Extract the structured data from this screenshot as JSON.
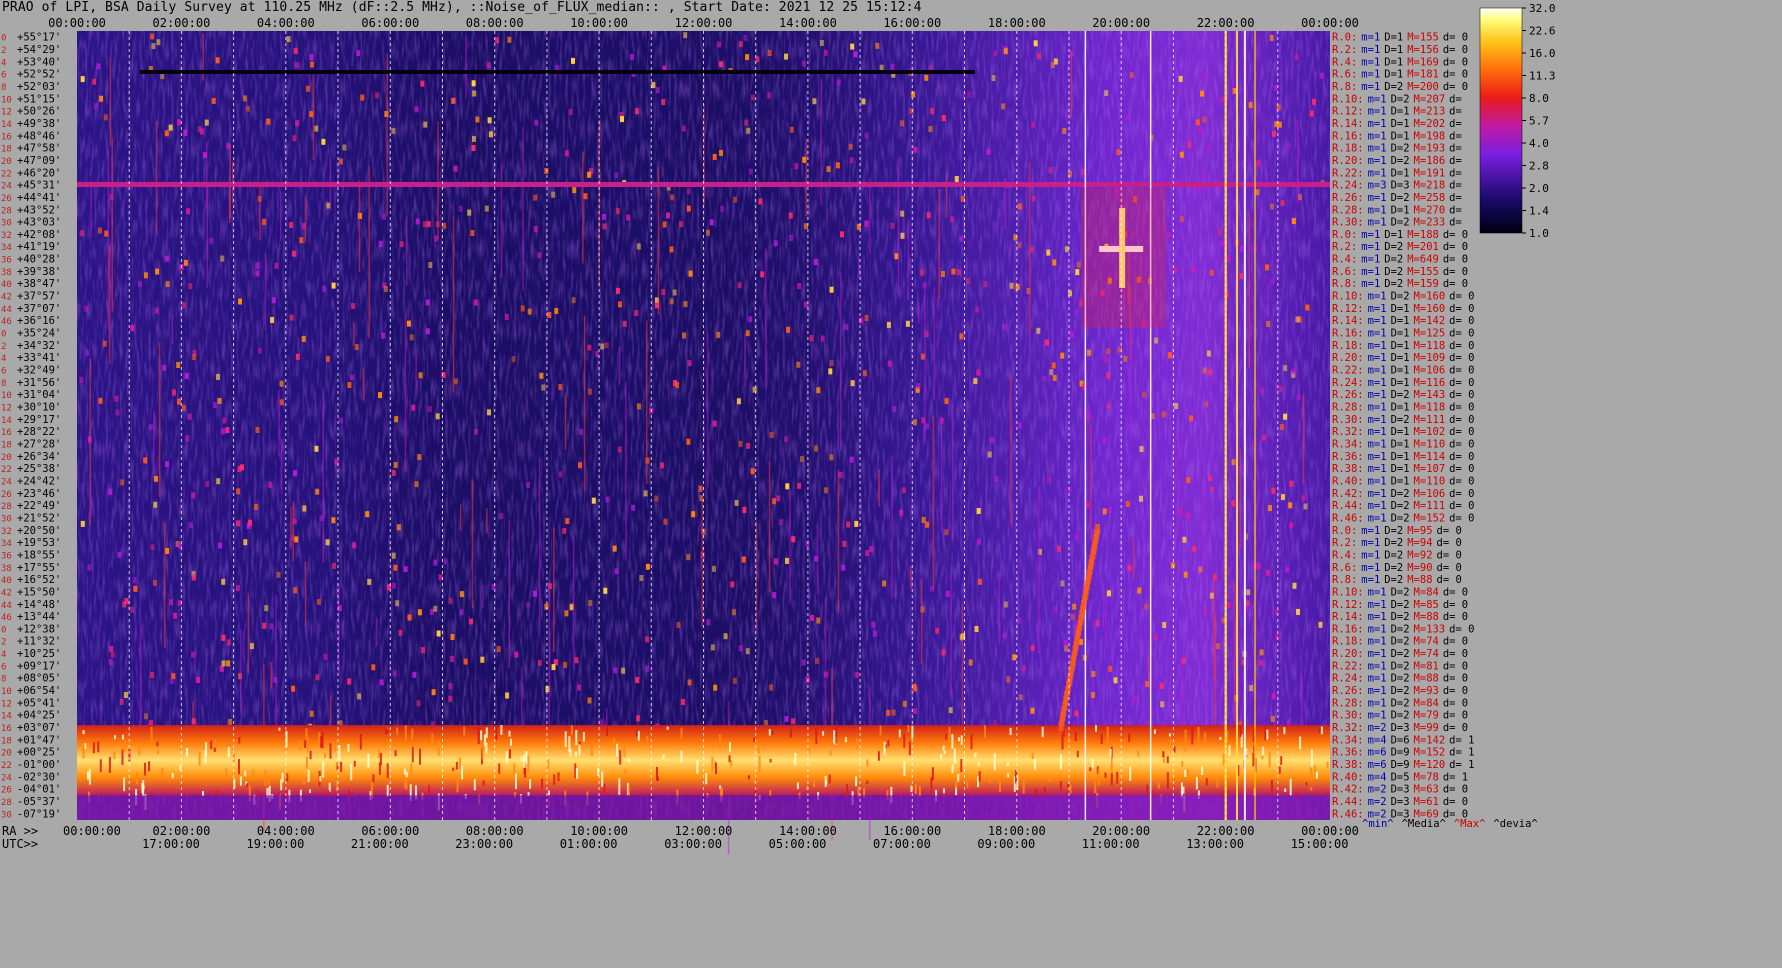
{
  "title": "PRAO of LPI, BSA Daily Survey at 110.25 MHz (dF::2.5 MHz), ::Noise_of_FLUX_median:: , Start Date: 2021 12 25 15:12:4",
  "axis": {
    "ra_prefix": "RA >>",
    "utc_prefix": "UTC>>",
    "ra_ticks": [
      "00:00:00",
      "02:00:00",
      "04:00:00",
      "06:00:00",
      "08:00:00",
      "10:00:00",
      "12:00:00",
      "14:00:00",
      "16:00:00",
      "18:00:00",
      "20:00:00",
      "22:00:00",
      "00:00:00"
    ],
    "utc_ticks": [
      "17:00:00",
      "19:00:00",
      "21:00:00",
      "23:00:00",
      "01:00:00",
      "03:00:00",
      "05:00:00",
      "07:00:00",
      "09:00:00",
      "11:00:00",
      "13:00:00",
      "15:00:00"
    ]
  },
  "colors": {
    "page_bg": "#a9a9a9",
    "stat_ra": "#cc0000",
    "stat_min": "#0000aa",
    "stat_median": "#000000",
    "stat_max": "#cc0000",
    "heat_low": "#0a0533",
    "heat_mid": "#6d1fd6",
    "heat_high": "#ff3a0a",
    "heat_top": "#ffffe8"
  },
  "legend": {
    "min": "^min^",
    "median": "^Media^",
    "max": "^Max^",
    "devia": "^devia^"
  },
  "chart_data": {
    "type": "heatmap",
    "title": "PRAO of LPI, BSA Daily Survey at 110.25 MHz (dF::2.5 MHz), ::Noise_of_FLUX_median:: , Start Date: 2021 12 25 15:12:4",
    "x_label_top": "RA",
    "x_label_bottom": "UTC",
    "x_range_ra_hours": [
      0,
      24
    ],
    "colorbar": {
      "ticks": [
        "32.0",
        "22.6",
        "16.0",
        "11.3",
        "8.0",
        "5.7",
        "4.0",
        "2.8",
        "2.0",
        "1.4",
        "1.0"
      ],
      "range": [
        1.0,
        32.0
      ],
      "scale": "log"
    },
    "declinations": [
      "+55°17'",
      "+54°29'",
      "+53°40'",
      "+52°52'",
      "+52°03'",
      "+51°15'",
      "+50°26'",
      "+49°38'",
      "+48°46'",
      "+47°58'",
      "+47°09'",
      "+46°20'",
      "+45°31'",
      "+44°41'",
      "+43°52'",
      "+43°03'",
      "+42°08'",
      "+41°19'",
      "+40°28'",
      "+39°38'",
      "+38°47'",
      "+37°57'",
      "+37°07'",
      "+36°16'",
      "+35°24'",
      "+34°32'",
      "+33°41'",
      "+32°49'",
      "+31°56'",
      "+31°04'",
      "+30°10'",
      "+29°17'",
      "+28°22'",
      "+27°28'",
      "+26°34'",
      "+25°38'",
      "+24°42'",
      "+23°46'",
      "+22°49'",
      "+21°52'",
      "+20°50'",
      "+19°53'",
      "+18°55'",
      "+17°55'",
      "+16°52'",
      "+15°50'",
      "+14°48'",
      "+13°44'",
      "+12°38'",
      "+11°32'",
      "+10°25'",
      "+09°17'",
      "+08°05'",
      "+06°54'",
      "+05°41'",
      "+04°25'",
      "+03°07'",
      "+01°47'",
      "+00°25'",
      "-01°00'",
      "-02°30'",
      "-04°01'",
      "-05°37'",
      "-07°19'"
    ],
    "row_stats": [
      {
        "ra": "R.0:",
        "min": "m=1",
        "med": "D=1",
        "max": "M=155",
        "dev": "d= 0"
      },
      {
        "ra": "R.2:",
        "min": "m=1",
        "med": "D=1",
        "max": "M=156",
        "dev": "d= 0"
      },
      {
        "ra": "R.4:",
        "min": "m=1",
        "med": "D=1",
        "max": "M=169",
        "dev": "d= 0"
      },
      {
        "ra": "R.6:",
        "min": "m=1",
        "med": "D=1",
        "max": "M=181",
        "dev": "d= 0"
      },
      {
        "ra": "R.8:",
        "min": "m=1",
        "med": "D=2",
        "max": "M=200",
        "dev": "d= 0"
      },
      {
        "ra": "R.10:",
        "min": "m=1",
        "med": "D=2",
        "max": "M=207",
        "dev": "d="
      },
      {
        "ra": "R.12:",
        "min": "m=1",
        "med": "D=1",
        "max": "M=213",
        "dev": "d="
      },
      {
        "ra": "R.14:",
        "min": "m=1",
        "med": "D=1",
        "max": "M=202",
        "dev": "d="
      },
      {
        "ra": "R.16:",
        "min": "m=1",
        "med": "D=1",
        "max": "M=198",
        "dev": "d="
      },
      {
        "ra": "R.18:",
        "min": "m=1",
        "med": "D=2",
        "max": "M=193",
        "dev": "d="
      },
      {
        "ra": "R.20:",
        "min": "m=1",
        "med": "D=2",
        "max": "M=186",
        "dev": "d="
      },
      {
        "ra": "R.22:",
        "min": "m=1",
        "med": "D=1",
        "max": "M=191",
        "dev": "d="
      },
      {
        "ra": "R.24:",
        "min": "m=3",
        "med": "D=3",
        "max": "M=218",
        "dev": "d="
      },
      {
        "ra": "R.26:",
        "min": "m=1",
        "med": "D=2",
        "max": "M=258",
        "dev": "d="
      },
      {
        "ra": "R.28:",
        "min": "m=1",
        "med": "D=1",
        "max": "M=270",
        "dev": "d="
      },
      {
        "ra": "R.30:",
        "min": "m=1",
        "med": "D=2",
        "max": "M=233",
        "dev": "d="
      },
      {
        "ra": "R.0:",
        "min": "m=1",
        "med": "D=1",
        "max": "M=188",
        "dev": "d= 0"
      },
      {
        "ra": "R.2:",
        "min": "m=1",
        "med": "D=2",
        "max": "M=201",
        "dev": "d= 0"
      },
      {
        "ra": "R.4:",
        "min": "m=1",
        "med": "D=2",
        "max": "M=649",
        "dev": "d= 0"
      },
      {
        "ra": "R.6:",
        "min": "m=1",
        "med": "D=2",
        "max": "M=155",
        "dev": "d= 0"
      },
      {
        "ra": "R.8:",
        "min": "m=1",
        "med": "D=2",
        "max": "M=159",
        "dev": "d= 0"
      },
      {
        "ra": "R.10:",
        "min": "m=1",
        "med": "D=2",
        "max": "M=160",
        "dev": "d= 0"
      },
      {
        "ra": "R.12:",
        "min": "m=1",
        "med": "D=1",
        "max": "M=160",
        "dev": "d= 0"
      },
      {
        "ra": "R.14:",
        "min": "m=1",
        "med": "D=1",
        "max": "M=142",
        "dev": "d= 0"
      },
      {
        "ra": "R.16:",
        "min": "m=1",
        "med": "D=1",
        "max": "M=125",
        "dev": "d= 0"
      },
      {
        "ra": "R.18:",
        "min": "m=1",
        "med": "D=1",
        "max": "M=118",
        "dev": "d= 0"
      },
      {
        "ra": "R.20:",
        "min": "m=1",
        "med": "D=1",
        "max": "M=109",
        "dev": "d= 0"
      },
      {
        "ra": "R.22:",
        "min": "m=1",
        "med": "D=1",
        "max": "M=106",
        "dev": "d= 0"
      },
      {
        "ra": "R.24:",
        "min": "m=1",
        "med": "D=1",
        "max": "M=116",
        "dev": "d= 0"
      },
      {
        "ra": "R.26:",
        "min": "m=1",
        "med": "D=2",
        "max": "M=143",
        "dev": "d= 0"
      },
      {
        "ra": "R.28:",
        "min": "m=1",
        "med": "D=1",
        "max": "M=118",
        "dev": "d= 0"
      },
      {
        "ra": "R.30:",
        "min": "m=1",
        "med": "D=2",
        "max": "M=111",
        "dev": "d= 0"
      },
      {
        "ra": "R.32:",
        "min": "m=1",
        "med": "D=1",
        "max": "M=102",
        "dev": "d= 0"
      },
      {
        "ra": "R.34:",
        "min": "m=1",
        "med": "D=1",
        "max": "M=110",
        "dev": "d= 0"
      },
      {
        "ra": "R.36:",
        "min": "m=1",
        "med": "D=1",
        "max": "M=114",
        "dev": "d= 0"
      },
      {
        "ra": "R.38:",
        "min": "m=1",
        "med": "D=1",
        "max": "M=107",
        "dev": "d= 0"
      },
      {
        "ra": "R.40:",
        "min": "m=1",
        "med": "D=1",
        "max": "M=110",
        "dev": "d= 0"
      },
      {
        "ra": "R.42:",
        "min": "m=1",
        "med": "D=2",
        "max": "M=106",
        "dev": "d= 0"
      },
      {
        "ra": "R.44:",
        "min": "m=1",
        "med": "D=2",
        "max": "M=111",
        "dev": "d= 0"
      },
      {
        "ra": "R.46:",
        "min": "m=1",
        "med": "D=2",
        "max": "M=152",
        "dev": "d= 0"
      },
      {
        "ra": "R.0:",
        "min": "m=1",
        "med": "D=2",
        "max": "M=95",
        "dev": "d= 0"
      },
      {
        "ra": "R.2:",
        "min": "m=1",
        "med": "D=2",
        "max": "M=94",
        "dev": "d= 0"
      },
      {
        "ra": "R.4:",
        "min": "m=1",
        "med": "D=2",
        "max": "M=92",
        "dev": "d= 0"
      },
      {
        "ra": "R.6:",
        "min": "m=1",
        "med": "D=2",
        "max": "M=90",
        "dev": "d= 0"
      },
      {
        "ra": "R.8:",
        "min": "m=1",
        "med": "D=2",
        "max": "M=88",
        "dev": "d= 0"
      },
      {
        "ra": "R.10:",
        "min": "m=1",
        "med": "D=2",
        "max": "M=84",
        "dev": "d= 0"
      },
      {
        "ra": "R.12:",
        "min": "m=1",
        "med": "D=2",
        "max": "M=85",
        "dev": "d= 0"
      },
      {
        "ra": "R.14:",
        "min": "m=1",
        "med": "D=2",
        "max": "M=88",
        "dev": "d= 0"
      },
      {
        "ra": "R.16:",
        "min": "m=1",
        "med": "D=2",
        "max": "M=133",
        "dev": "d= 0"
      },
      {
        "ra": "R.18:",
        "min": "m=1",
        "med": "D=2",
        "max": "M=74",
        "dev": "d= 0"
      },
      {
        "ra": "R.20:",
        "min": "m=1",
        "med": "D=2",
        "max": "M=74",
        "dev": "d= 0"
      },
      {
        "ra": "R.22:",
        "min": "m=1",
        "med": "D=2",
        "max": "M=81",
        "dev": "d= 0"
      },
      {
        "ra": "R.24:",
        "min": "m=1",
        "med": "D=2",
        "max": "M=88",
        "dev": "d= 0"
      },
      {
        "ra": "R.26:",
        "min": "m=1",
        "med": "D=2",
        "max": "M=93",
        "dev": "d= 0"
      },
      {
        "ra": "R.28:",
        "min": "m=1",
        "med": "D=2",
        "max": "M=84",
        "dev": "d= 0"
      },
      {
        "ra": "R.30:",
        "min": "m=1",
        "med": "D=2",
        "max": "M=79",
        "dev": "d= 0"
      },
      {
        "ra": "R.32:",
        "min": "m=2",
        "med": "D=3",
        "max": "M=99",
        "dev": "d= 0"
      },
      {
        "ra": "R.34:",
        "min": "m=4",
        "med": "D=6",
        "max": "M=142",
        "dev": "d= 1"
      },
      {
        "ra": "R.36:",
        "min": "m=6",
        "med": "D=9",
        "max": "M=152",
        "dev": "d= 1"
      },
      {
        "ra": "R.38:",
        "min": "m=6",
        "med": "D=9",
        "max": "M=120",
        "dev": "d= 1"
      },
      {
        "ra": "R.40:",
        "min": "m=4",
        "med": "D=5",
        "max": "M=78",
        "dev": "d= 1"
      },
      {
        "ra": "R.42:",
        "min": "m=2",
        "med": "D=3",
        "max": "M=63",
        "dev": "d= 0"
      },
      {
        "ra": "R.44:",
        "min": "m=2",
        "med": "D=3",
        "max": "M=61",
        "dev": "d= 0"
      },
      {
        "ra": "R.46:",
        "min": "m=2",
        "med": "D=3",
        "max": "M=69",
        "dev": "d= 0"
      }
    ]
  }
}
